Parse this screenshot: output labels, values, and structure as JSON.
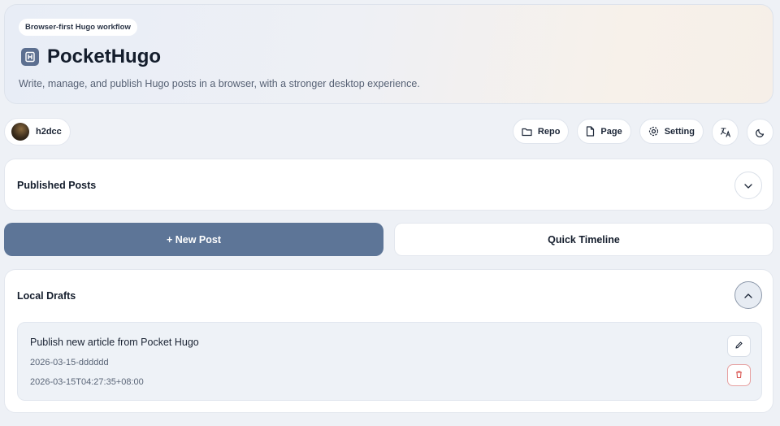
{
  "hero": {
    "badge": "Browser-first Hugo workflow",
    "title": "PocketHugo",
    "description": "Write, manage, and publish Hugo posts in a browser, with a stronger desktop experience."
  },
  "user": {
    "name": "h2dcc"
  },
  "toolbar": {
    "repo_label": "Repo",
    "page_label": "Page",
    "setting_label": "Setting",
    "icons": [
      "folder-icon",
      "file-icon",
      "gear-icon",
      "translate-icon",
      "moon-icon"
    ]
  },
  "published": {
    "title": "Published Posts",
    "expanded": false
  },
  "actions": {
    "new_post_label": "+ New Post",
    "timeline_label": "Quick Timeline"
  },
  "drafts": {
    "title": "Local Drafts",
    "expanded": true,
    "items": [
      {
        "title": "Publish new article from Pocket Hugo",
        "slug": "2026-03-15-dddddd",
        "date": "2026-03-15T04:27:35+08:00"
      }
    ]
  },
  "colors": {
    "accent": "#5d7597",
    "background": "#eef1f6",
    "danger": "#d9534f"
  }
}
